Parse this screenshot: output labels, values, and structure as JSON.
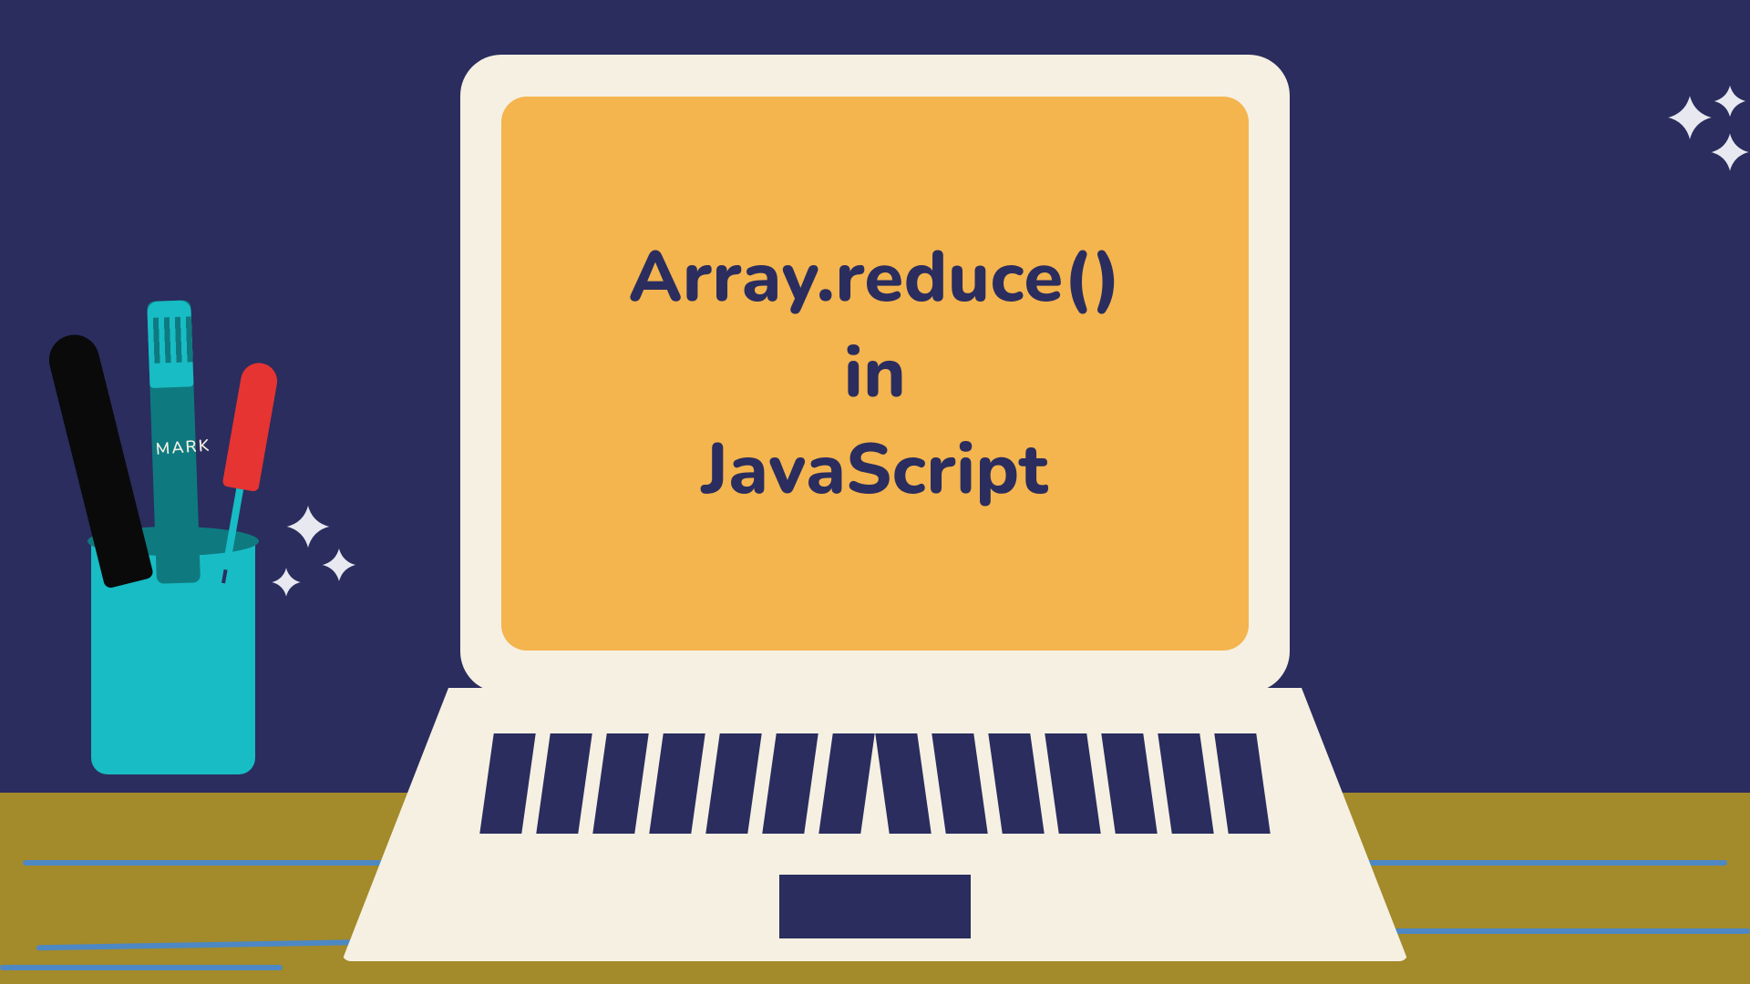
{
  "screen": {
    "line1": "Array.reduce()",
    "line2": "in",
    "line3": "JavaScript"
  },
  "cup": {
    "marker_label": "MARK"
  },
  "icons": {
    "sparkle": "sparkle-icon",
    "pen_black": "pen-black-icon",
    "pen_teal": "pen-teal-icon",
    "pen_red": "pen-red-icon",
    "cup": "cup-icon",
    "laptop": "laptop-icon"
  },
  "colors": {
    "background": "#2a2d5e",
    "screen_bg": "#f4b44e",
    "laptop_body": "#f6f0e2",
    "table": "#a38a2a",
    "cup": "#18bcc4",
    "accent_red": "#e63433"
  }
}
